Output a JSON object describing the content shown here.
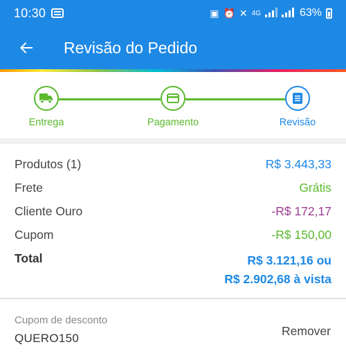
{
  "status_bar": {
    "time": "10:30",
    "network": "4G",
    "battery": "63%"
  },
  "header": {
    "title": "Revisão do Pedido",
    "back_icon": "arrow-left-icon"
  },
  "stepper": {
    "steps": [
      {
        "label": "Entrega",
        "icon": "truck-icon",
        "state": "done"
      },
      {
        "label": "Pagamento",
        "icon": "credit-card-icon",
        "state": "done"
      },
      {
        "label": "Revisão",
        "icon": "list-icon",
        "state": "active"
      }
    ]
  },
  "summary": {
    "products_label": "Produtos (1)",
    "products_value": "R$ 3.443,33",
    "shipping_label": "Frete",
    "shipping_value": "Grátis",
    "gold_label": "Cliente Ouro",
    "gold_value": "-R$ 172,17",
    "coupon_label": "Cupom",
    "coupon_value": "-R$ 150,00",
    "total_label": "Total",
    "total_value_line1": "R$ 3.121,16 ou",
    "total_value_line2": "R$ 2.902,68 à vista"
  },
  "coupon": {
    "label": "Cupom de desconto",
    "code": "QUERO150",
    "remove_label": "Remover"
  },
  "colors": {
    "primary": "#1e88e5",
    "success": "#5bb92e",
    "discount_purple": "#9c3a8f"
  }
}
